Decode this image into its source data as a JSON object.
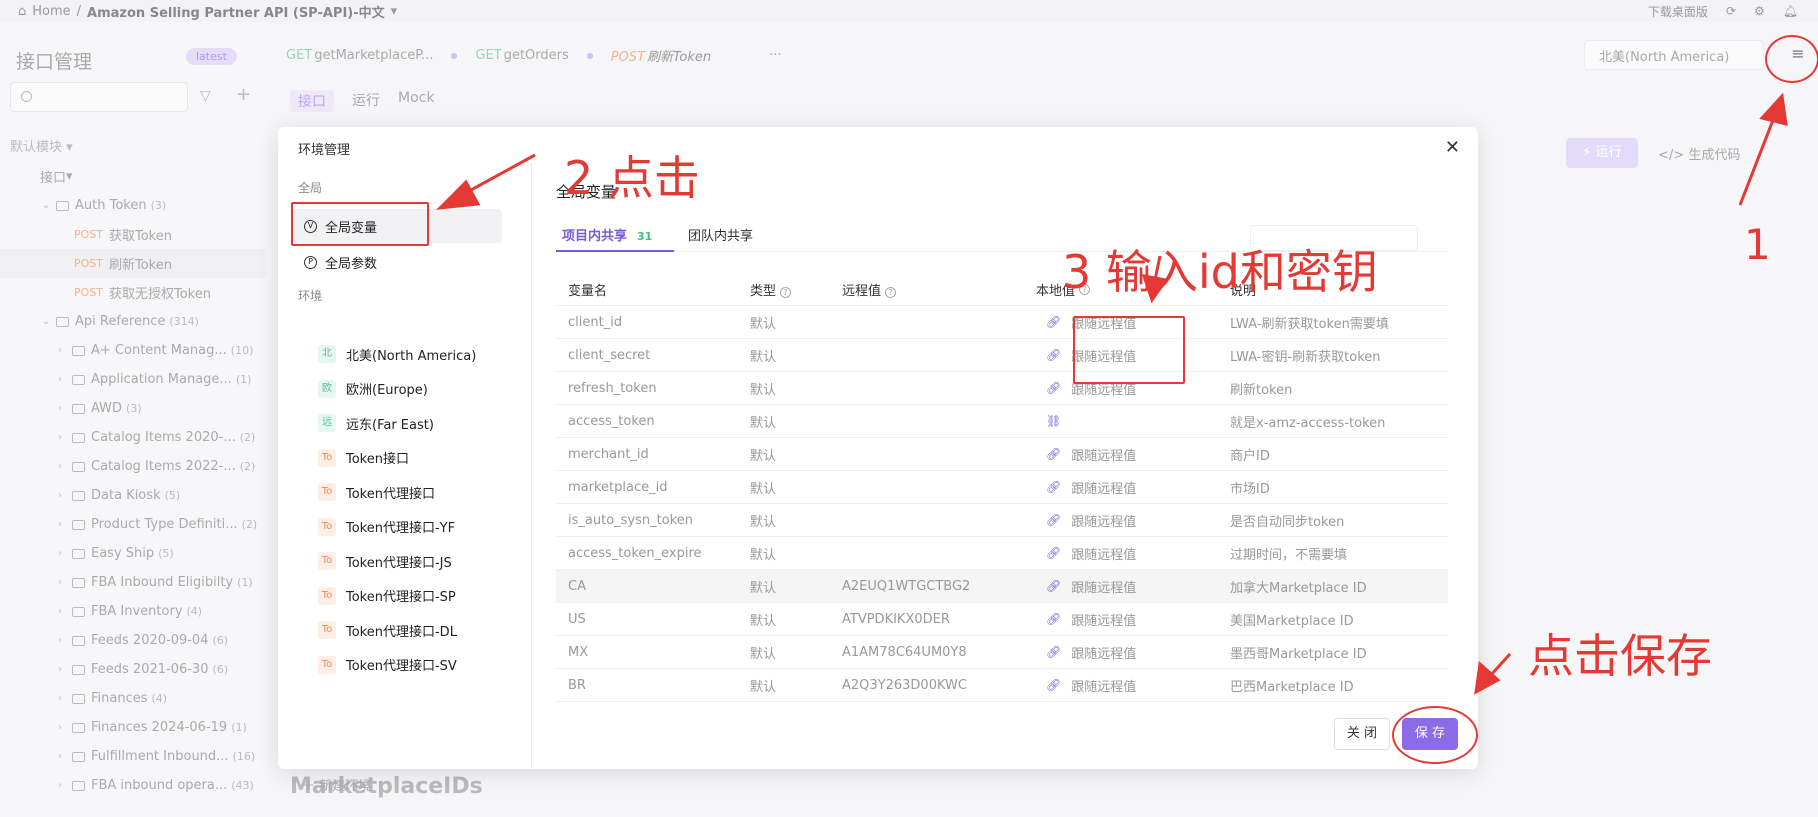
{
  "topbar": {
    "home": "Home",
    "project": "Amazon Selling Partner API (SP-API)-中文",
    "download": "下载桌面版"
  },
  "sidebar": {
    "title": "接口管理",
    "version": "latest",
    "module": "默认模块",
    "tree": [
      {
        "label": "接口",
        "count": "",
        "method": "",
        "level": 0,
        "kind": "root"
      },
      {
        "label": "Auth Token",
        "count": "(3)",
        "method": "",
        "level": 1,
        "kind": "folder"
      },
      {
        "label": "获取Token",
        "count": "",
        "method": "POST",
        "level": 2,
        "kind": "api"
      },
      {
        "label": "刷新Token",
        "count": "",
        "method": "POST",
        "level": 2,
        "kind": "api"
      },
      {
        "label": "获取无授权Token",
        "count": "",
        "method": "POST",
        "level": 2,
        "kind": "api"
      },
      {
        "label": "Api Reference",
        "count": "(314)",
        "method": "",
        "level": 1,
        "kind": "folder"
      },
      {
        "label": "A+ Content Manag...",
        "count": "(10)",
        "method": "",
        "level": 2,
        "kind": "folder"
      },
      {
        "label": "Application Manage...",
        "count": "(1)",
        "method": "",
        "level": 2,
        "kind": "folder"
      },
      {
        "label": "AWD",
        "count": "(3)",
        "method": "",
        "level": 2,
        "kind": "folder"
      },
      {
        "label": "Catalog Items 2020-...",
        "count": "(2)",
        "method": "",
        "level": 2,
        "kind": "folder"
      },
      {
        "label": "Catalog Items 2022-...",
        "count": "(2)",
        "method": "",
        "level": 2,
        "kind": "folder"
      },
      {
        "label": "Data Kiosk",
        "count": "(5)",
        "method": "",
        "level": 2,
        "kind": "folder"
      },
      {
        "label": "Product Type Definiti...",
        "count": "(2)",
        "method": "",
        "level": 2,
        "kind": "folder"
      },
      {
        "label": "Easy Ship",
        "count": "(5)",
        "method": "",
        "level": 2,
        "kind": "folder"
      },
      {
        "label": "FBA Inbound Eligibilty",
        "count": "(1)",
        "method": "",
        "level": 2,
        "kind": "folder"
      },
      {
        "label": "FBA Inventory",
        "count": "(4)",
        "method": "",
        "level": 2,
        "kind": "folder"
      },
      {
        "label": "Feeds 2020-09-04",
        "count": "(6)",
        "method": "",
        "level": 2,
        "kind": "folder"
      },
      {
        "label": "Feeds 2021-06-30",
        "count": "(6)",
        "method": "",
        "level": 2,
        "kind": "folder"
      },
      {
        "label": "Finances",
        "count": "(4)",
        "method": "",
        "level": 2,
        "kind": "folder"
      },
      {
        "label": "Finances 2024-06-19",
        "count": "(1)",
        "method": "",
        "level": 2,
        "kind": "folder"
      },
      {
        "label": "Fulfillment Inbound...",
        "count": "(16)",
        "method": "",
        "level": 2,
        "kind": "folder"
      },
      {
        "label": "FBA inbound opera...",
        "count": "(43)",
        "method": "",
        "level": 2,
        "kind": "folder"
      }
    ]
  },
  "tabs": [
    {
      "method": "GET",
      "label": "getMarketplaceP..."
    },
    {
      "method": "GET",
      "label": "getOrders"
    },
    {
      "method": "POST",
      "label": "刷新Token"
    }
  ],
  "subtabs": [
    "接口",
    "运行",
    "Mock"
  ],
  "env_selected": "北美(North America)",
  "run_label": "运行",
  "gencode_label": "生成代码",
  "section_heading": "MarketplaceIDs",
  "modal": {
    "title": "环境管理",
    "global_section": "全局",
    "global_vars": "全局变量",
    "global_params": "全局参数",
    "env_section": "环境",
    "envs": [
      {
        "badge": "北",
        "name": "北美(North America)",
        "color": "green"
      },
      {
        "badge": "欧",
        "name": "欧洲(Europe)",
        "color": "green"
      },
      {
        "badge": "远",
        "name": "远东(Far East)",
        "color": "green"
      },
      {
        "badge": "To",
        "name": "Token接口",
        "color": "orange"
      },
      {
        "badge": "To",
        "name": "Token代理接口",
        "color": "orange"
      },
      {
        "badge": "To",
        "name": "Token代理接口-YF",
        "color": "orange"
      },
      {
        "badge": "To",
        "name": "Token代理接口-JS",
        "color": "orange"
      },
      {
        "badge": "To",
        "name": "Token代理接口-SP",
        "color": "orange"
      },
      {
        "badge": "To",
        "name": "Token代理接口-DL",
        "color": "orange"
      },
      {
        "badge": "To",
        "name": "Token代理接口-SV",
        "color": "orange"
      }
    ],
    "new_env": "新建环境",
    "heading": "全局变量",
    "tab_project": "项目内共享",
    "tab_project_count": "31",
    "tab_team": "团队内共享",
    "columns": [
      "变量名",
      "类型",
      "远程值",
      "本地值",
      "说明"
    ],
    "rows": [
      {
        "name": "client_id",
        "type": "默认",
        "remote": "",
        "local": "跟随远程值",
        "desc": "LWA-刷新获取token需要填"
      },
      {
        "name": "client_secret",
        "type": "默认",
        "remote": "",
        "local": "跟随远程值",
        "desc": "LWA-密钥-刷新获取token"
      },
      {
        "name": "refresh_token",
        "type": "默认",
        "remote": "",
        "local": "跟随远程值",
        "desc": "刷新token"
      },
      {
        "name": "access_token",
        "type": "默认",
        "remote": "",
        "local": "",
        "desc": "就是x-amz-access-token"
      },
      {
        "name": "merchant_id",
        "type": "默认",
        "remote": "",
        "local": "跟随远程值",
        "desc": "商户ID"
      },
      {
        "name": "marketplace_id",
        "type": "默认",
        "remote": "",
        "local": "跟随远程值",
        "desc": "市场ID"
      },
      {
        "name": "is_auto_sysn_token",
        "type": "默认",
        "remote": "",
        "local": "跟随远程值",
        "desc": "是否自动同步token"
      },
      {
        "name": "access_token_expire",
        "type": "默认",
        "remote": "",
        "local": "跟随远程值",
        "desc": "过期时间，不需要填"
      },
      {
        "name": "CA",
        "type": "默认",
        "remote": "A2EUQ1WTGCTBG2",
        "local": "跟随远程值",
        "desc": "加拿大Marketplace ID"
      },
      {
        "name": "US",
        "type": "默认",
        "remote": "ATVPDKIKX0DER",
        "local": "跟随远程值",
        "desc": "美国Marketplace ID"
      },
      {
        "name": "MX",
        "type": "默认",
        "remote": "A1AM78C64UM0Y8",
        "local": "跟随远程值",
        "desc": "墨西哥Marketplace ID"
      },
      {
        "name": "BR",
        "type": "默认",
        "remote": "A2Q3Y263D00KWC",
        "local": "跟随远程值",
        "desc": "巴西Marketplace ID"
      }
    ],
    "close_label": "关 闭",
    "save_label": "保 存"
  },
  "annotations": {
    "step1": "1",
    "step2": "2 点击",
    "step3": "3 输入id和密钥",
    "save_hint": "点击保存",
    "color": "#e53935"
  }
}
